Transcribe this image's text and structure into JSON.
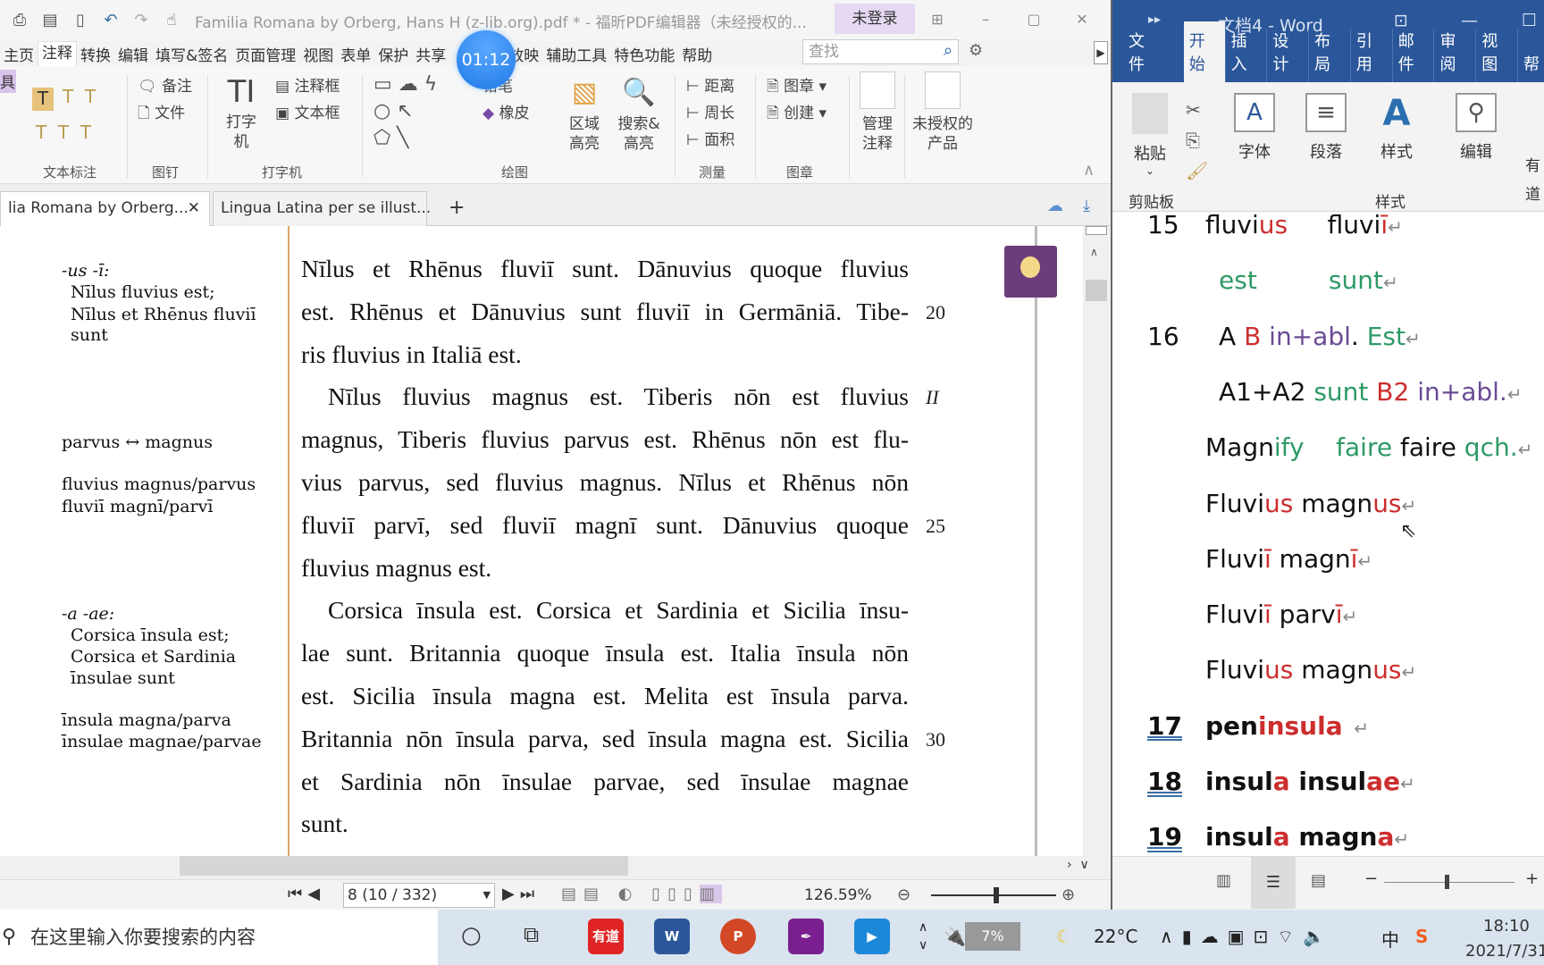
{
  "pdf_app": {
    "title": "Familia Romana by Orberg, Hans H (z-lib.org).pdf * - 福昕PDF编辑器（未经授权的...",
    "login": "未登录",
    "timer": "01:12",
    "menu": [
      "主页",
      "注释",
      "转换",
      "编辑",
      "填写&签名",
      "页面管理",
      "视图",
      "表单",
      "保护",
      "共享",
      "放映",
      "辅助工具",
      "特色功能",
      "帮助"
    ],
    "active_menu": "注释",
    "search_placeholder": "查找",
    "ribbon": {
      "side_tab": "具",
      "groups": {
        "text_markup": "文本标注",
        "pin": "图钉",
        "typewriter": "打字机",
        "drawing": "绘图",
        "measure": "测量",
        "stamp": "图章"
      },
      "note": "备注",
      "file": "文件",
      "typewriter_btn": "打字机",
      "callout": "注释框",
      "textbox": "文本框",
      "pencil": "铅笔",
      "eraser": "橡皮",
      "area_highlight": "区域高亮",
      "search_highlight": "搜索&高亮",
      "distance": "距离",
      "perimeter": "周长",
      "area": "面积",
      "stamp_btn": "图章",
      "create": "创建",
      "manage_comments": "管理注释",
      "unlicensed": "未授权的产品"
    },
    "tabs": [
      {
        "label": "lia Romana by Orberg...",
        "active": true
      },
      {
        "label": "Lingua Latina per se illust...",
        "active": false
      }
    ],
    "margin_notes": [
      {
        "text": "-us -ī:",
        "italic": true,
        "indent": false
      },
      {
        "text": "Nīlus fluvius est;",
        "indent": true
      },
      {
        "text": "Nīlus et Rhēnus fluviī",
        "indent": true
      },
      {
        "text": "sunt",
        "indent": true
      },
      {
        "text": "parvus ↔ magnus",
        "indent": false
      },
      {
        "text": "fluvius magnus/parvus",
        "indent": false
      },
      {
        "text": "fluviī magnī/parvī",
        "indent": false
      },
      {
        "text": "-a -ae:",
        "italic": true,
        "indent": false
      },
      {
        "text": "Corsica īnsula est;",
        "indent": true
      },
      {
        "text": "Corsica et Sardinia",
        "indent": true
      },
      {
        "text": "īnsulae sunt",
        "indent": true
      },
      {
        "text": "īnsula magna/parva",
        "indent": false
      },
      {
        "text": "īnsulae magnae/parvae",
        "indent": false
      }
    ],
    "body_lines": [
      "Nīlus et Rhēnus fluviī sunt. Dānuvius quoque fluvius",
      "est. Rhēnus et Dānuvius sunt fluviī in Germāniā. Tibe-",
      "ris fluvius in Italiā est.",
      "Nīlus fluvius magnus est. Tiberis nōn est fluvius",
      "magnus, Tiberis fluvius parvus est. Rhēnus nōn est flu-",
      "vius parvus, sed fluvius magnus. Nīlus et Rhēnus nōn",
      "fluviī parvī, sed fluviī magnī sunt. Dānuvius quoque",
      "fluvius magnus est.",
      "Corsica īnsula est. Corsica et Sardinia et Sicilia īnsu-",
      "lae sunt. Britannia quoque īnsula est. Italia īnsula nōn",
      "est. Sicilia īnsula magna est. Melita est īnsula parva.",
      "Britannia nōn īnsula parva, sed īnsula magna est. Sicilia",
      "et Sardinia nōn īnsulae parvae, sed īnsulae magnae",
      "sunt."
    ],
    "line_numbers": {
      "1": "20",
      "3": "II",
      "6": "25",
      "11": "30"
    },
    "page_field": "8 (10 / 332)",
    "zoom": "126.59%",
    "accent": "#6b3d7a"
  },
  "taskbar": {
    "search_placeholder": "在这里输入你要搜索的内容",
    "apps": [
      "有道",
      "W",
      "P",
      "",
      ""
    ],
    "battery": "7%",
    "temperature": "22°C",
    "ime": "中",
    "time": "18:10",
    "date": "2021/7/31"
  },
  "word_app": {
    "title": "文档4 - Word",
    "tabs": [
      "文件",
      "开始",
      "插入",
      "设计",
      "布局",
      "引用",
      "邮件",
      "审阅",
      "视图",
      "帮"
    ],
    "active_tab": "开始",
    "ribbon": {
      "paste": "粘贴",
      "font": "字体",
      "paragraph": "段落",
      "styles": "样式",
      "editing": "编辑",
      "clipboard": "剪贴板",
      "styles_group": "样式",
      "extra1": "有道",
      "extra2": "有道"
    },
    "colors": {
      "red": "#cc2e2e",
      "green": "#2e9a66",
      "purple": "#6b4a96",
      "black": "#111111"
    },
    "lines": [
      {
        "num": "15",
        "segs": [
          [
            "fluvi",
            "black"
          ],
          [
            "us",
            "red"
          ],
          [
            "     fluvi",
            "black"
          ],
          [
            "ī",
            "red"
          ],
          [
            "↵",
            "mark"
          ]
        ]
      },
      {
        "num": "",
        "pad": true,
        "segs": [
          [
            "est",
            "green"
          ],
          [
            "         sunt",
            "green"
          ],
          [
            "↵",
            "mark"
          ]
        ]
      },
      {
        "num": "16",
        "pad": true,
        "segs": [
          [
            "A ",
            "black"
          ],
          [
            "B ",
            "red"
          ],
          [
            "in+abl",
            "purple"
          ],
          [
            ". ",
            "black"
          ],
          [
            "Est",
            "green"
          ],
          [
            "↵",
            "mark"
          ]
        ]
      },
      {
        "num": "",
        "pad": true,
        "segs": [
          [
            "A1+A2 ",
            "black"
          ],
          [
            "sunt ",
            "green"
          ],
          [
            "B2 ",
            "red"
          ],
          [
            "in+abl.",
            "purple"
          ],
          [
            "↵",
            "mark"
          ]
        ]
      },
      {
        "num": "",
        "segs": [
          [
            "Magn",
            "black"
          ],
          [
            "ify    faire",
            "green"
          ],
          [
            " faire ",
            "black"
          ],
          [
            "qch.",
            "green"
          ],
          [
            "↵",
            "mark"
          ]
        ]
      },
      {
        "num": "",
        "segs": [
          [
            "Fluvi",
            "black"
          ],
          [
            "us",
            "red"
          ],
          [
            " magn",
            "black"
          ],
          [
            "us",
            "red"
          ],
          [
            "↵",
            "mark"
          ]
        ]
      },
      {
        "num": "",
        "segs": [
          [
            "Fluvi",
            "black"
          ],
          [
            "ī",
            "red"
          ],
          [
            " magn",
            "black"
          ],
          [
            "ī",
            "red"
          ],
          [
            "↵",
            "mark"
          ]
        ]
      },
      {
        "num": "",
        "segs": [
          [
            "Fluvi",
            "black"
          ],
          [
            "ī",
            "red"
          ],
          [
            " parv",
            "black"
          ],
          [
            "ī",
            "red"
          ],
          [
            "↵",
            "mark"
          ]
        ]
      },
      {
        "num": "",
        "segs": [
          [
            "Fluvi",
            "black"
          ],
          [
            "us",
            "red"
          ],
          [
            " magn",
            "black"
          ],
          [
            "us",
            "red"
          ],
          [
            "↵",
            "mark"
          ]
        ]
      },
      {
        "num": "17",
        "bold": true,
        "segs": [
          [
            "pen",
            "black"
          ],
          [
            "insula",
            "red"
          ],
          [
            "  ↵",
            "mark"
          ]
        ]
      },
      {
        "num": "18",
        "bold": true,
        "segs": [
          [
            "insul",
            "black"
          ],
          [
            "a",
            "red"
          ],
          [
            " insul",
            "black"
          ],
          [
            "ae",
            "red"
          ],
          [
            "↵",
            "mark"
          ]
        ]
      },
      {
        "num": "19",
        "bold": true,
        "segs": [
          [
            "insul",
            "black"
          ],
          [
            "a",
            "red"
          ],
          [
            " magn",
            "black"
          ],
          [
            "a",
            "red"
          ],
          [
            "↵",
            "mark"
          ]
        ]
      }
    ]
  }
}
